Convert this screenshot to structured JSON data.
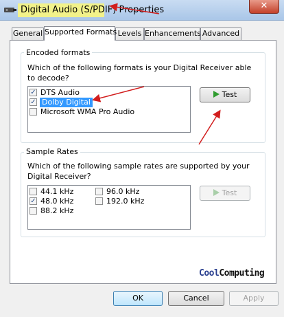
{
  "window": {
    "title_highlight": "Digital Audio (S/PDIF)",
    "title_rest": "Properties",
    "close_glyph": "✕",
    "icon": "speaker-icon"
  },
  "tabs": [
    {
      "label": "General"
    },
    {
      "label": "Supported Formats"
    },
    {
      "label": "Levels"
    },
    {
      "label": "Enhancements"
    },
    {
      "label": "Advanced"
    }
  ],
  "encoded": {
    "legend": "Encoded formats",
    "question": "Which of the following formats is your Digital Receiver able to decode?",
    "items": [
      {
        "label": "DTS Audio",
        "checked": true
      },
      {
        "label": "Dolby Digital",
        "checked": true
      },
      {
        "label": "Microsoft WMA Pro Audio",
        "checked": false
      }
    ],
    "test_label": "Test"
  },
  "rates": {
    "legend": "Sample Rates",
    "question": "Which of the following sample rates are supported by your Digital Receiver?",
    "items": [
      {
        "label": "44.1 kHz",
        "checked": false
      },
      {
        "label": "48.0 kHz",
        "checked": true
      },
      {
        "label": "88.2 kHz",
        "checked": false
      },
      {
        "label": "96.0 kHz",
        "checked": false
      },
      {
        "label": "192.0 kHz",
        "checked": false
      }
    ],
    "test_label": "Test"
  },
  "logo": {
    "part1": "Cool",
    "part2": "Computing",
    "color1": "#2a3f8f",
    "color2": "#111111"
  },
  "buttons": {
    "ok": "OK",
    "cancel": "Cancel",
    "apply": "Apply"
  },
  "colors": {
    "annotation": "#d21e1e",
    "selection": "#3399ff",
    "highlight": "#f2f28a"
  }
}
